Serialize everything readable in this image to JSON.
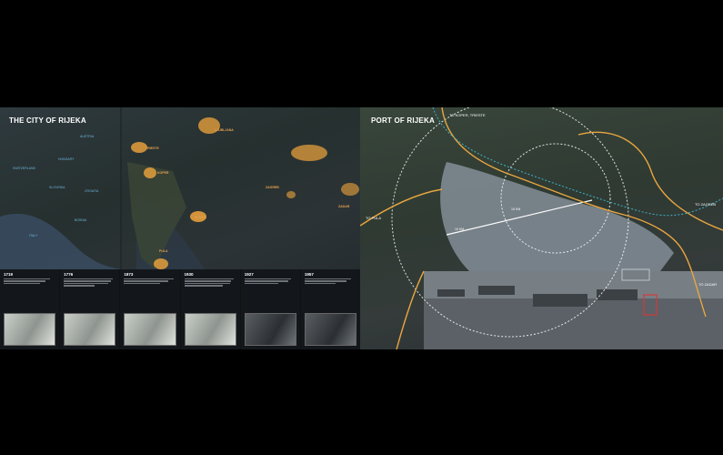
{
  "left_panel": {
    "title": "THE CITY OF RIJEKA",
    "countries": [
      "AUSTRIA",
      "HUNGARY",
      "SWITZERLAND",
      "SLOVENIA",
      "CROATIA",
      "BOSNIA",
      "ITALY"
    ],
    "cities": [
      "LJUBLJANA",
      "TRIESTE",
      "KOPER",
      "RIJEKA",
      "PULA",
      "ZAGREB",
      "ZADAR"
    ],
    "timeline": [
      {
        "year": "1719"
      },
      {
        "year": "1776"
      },
      {
        "year": "1873"
      },
      {
        "year": "1930"
      },
      {
        "year": "1927"
      },
      {
        "year": "1957"
      }
    ]
  },
  "right_panel": {
    "title": "PORT OF RIJEKA",
    "routes": {
      "north": "TO KOPER, TRIESTE",
      "west": "TO PULA",
      "east": "TO ZAGREB",
      "south": "TO ZADAR"
    },
    "distances": [
      "10 KM",
      "15 KM"
    ]
  },
  "colors": {
    "route": "#e8a640",
    "rail": "#3fb3c9",
    "city_glow": "#f0a53c",
    "label_blue": "#6fb3d9"
  }
}
